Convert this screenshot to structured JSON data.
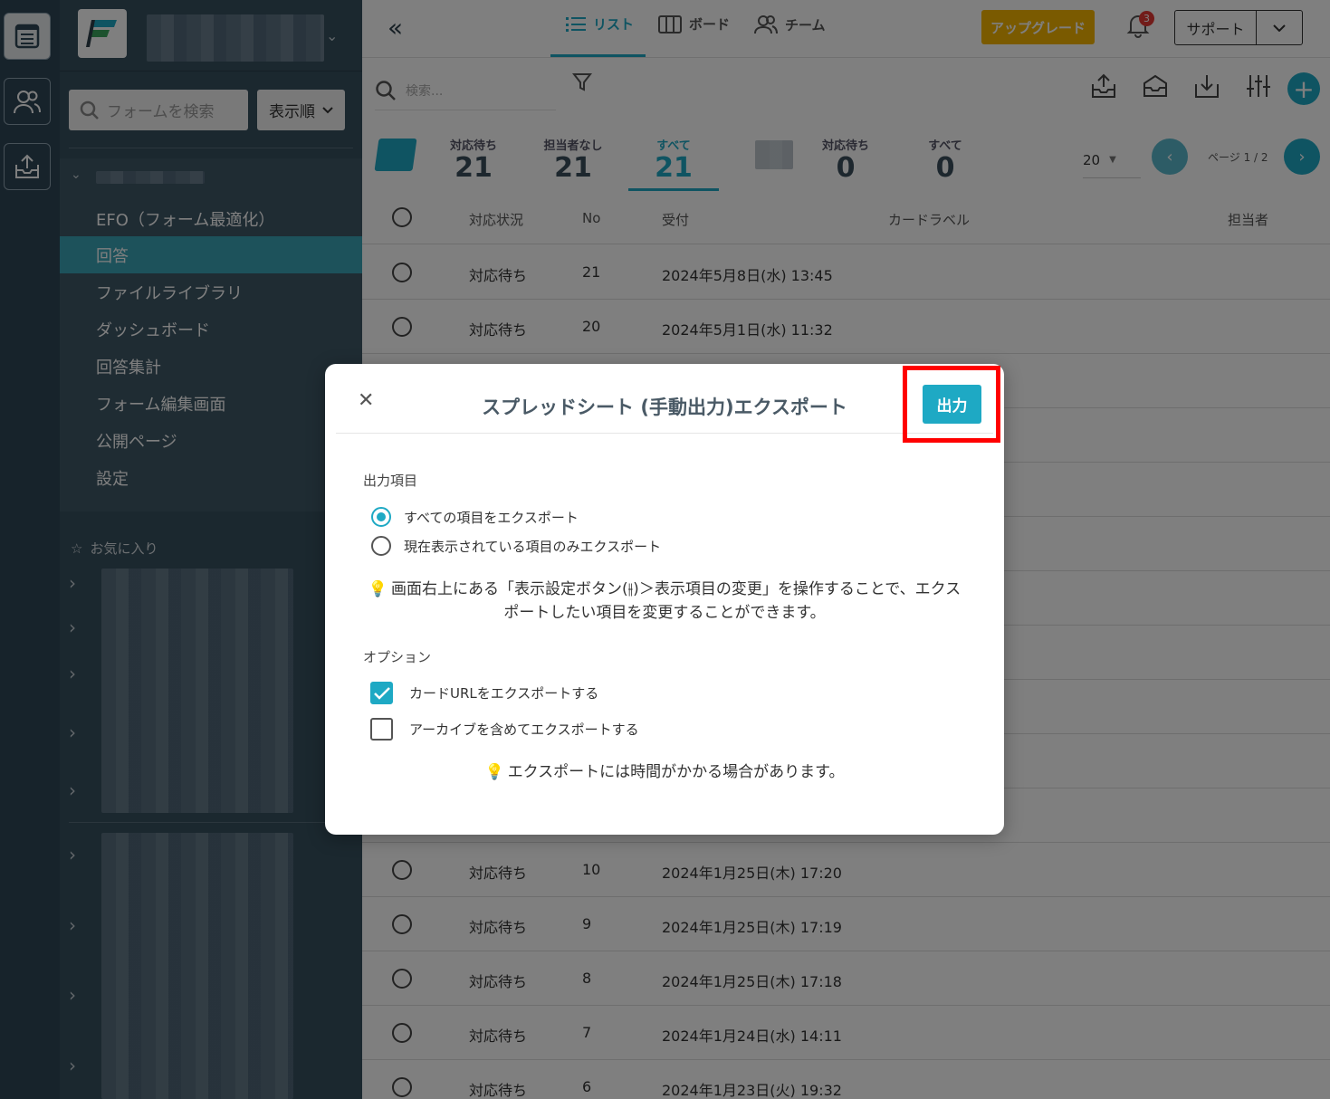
{
  "colors": {
    "accent": "#1ea9c4",
    "upgrade": "#f4b400",
    "highlight": "#ff0000",
    "sidebar": "#37505f"
  },
  "sidebar": {
    "search_placeholder": "フォームを検索",
    "sort_label": "表示順",
    "menu": [
      {
        "label": "EFO（フォーム最適化）"
      },
      {
        "label": "回答"
      },
      {
        "label": "ファイルライブラリ"
      },
      {
        "label": "ダッシュボード"
      },
      {
        "label": "回答集計"
      },
      {
        "label": "フォーム編集画面"
      },
      {
        "label": "公開ページ"
      },
      {
        "label": "設定"
      }
    ],
    "favorites_label": "お気に入り"
  },
  "topbar": {
    "tabs": [
      {
        "label": "リスト"
      },
      {
        "label": "ボード"
      },
      {
        "label": "チーム"
      }
    ],
    "upgrade_label": "アップグレード",
    "notification_count": "3",
    "support_label": "サポート"
  },
  "toolbar": {
    "search_placeholder": "検索..."
  },
  "stats": [
    {
      "label": "対応待ち",
      "value": "21"
    },
    {
      "label": "担当者なし",
      "value": "21"
    },
    {
      "label": "すべて",
      "value": "21"
    },
    {
      "label": "対応待ち",
      "value": "0"
    },
    {
      "label": "すべて",
      "value": "0"
    }
  ],
  "pager": {
    "per_page": "20",
    "page_label": "ページ 1 / 2"
  },
  "table": {
    "headers": {
      "status": "対応状況",
      "no": "No",
      "received": "受付",
      "card_label": "カードラベル",
      "assignee": "担当者"
    },
    "rows": [
      {
        "status": "対応待ち",
        "no": "21",
        "received": "2024年5月8日(水) 13:45"
      },
      {
        "status": "対応待ち",
        "no": "20",
        "received": "2024年5月1日(水) 11:32"
      },
      {
        "status": "対応待ち",
        "no": "10",
        "received": "2024年1月25日(木) 17:20"
      },
      {
        "status": "対応待ち",
        "no": "9",
        "received": "2024年1月25日(木) 17:19"
      },
      {
        "status": "対応待ち",
        "no": "8",
        "received": "2024年1月25日(木) 17:18"
      },
      {
        "status": "対応待ち",
        "no": "7",
        "received": "2024年1月24日(水) 14:11"
      },
      {
        "status": "対応待ち",
        "no": "6",
        "received": "2024年1月23日(火) 19:32"
      }
    ]
  },
  "modal": {
    "title": "スプレッドシート (手動出力)エクスポート",
    "output_button": "出力",
    "section_items": "出力項目",
    "radio_all": "すべての項目をエクスポート",
    "radio_visible": "現在表示されている項目のみエクスポート",
    "hint_settings": "画面右上にある「表示設定ボタン(⫲)＞表示項目の変更」を操作することで、エクスポートしたい項目を変更することができます。",
    "section_options": "オプション",
    "check_card_url": "カードURLをエクスポートする",
    "check_archive": "アーカイブを含めてエクスポートする",
    "hint_time": "エクスポートには時間がかかる場合があります。"
  }
}
